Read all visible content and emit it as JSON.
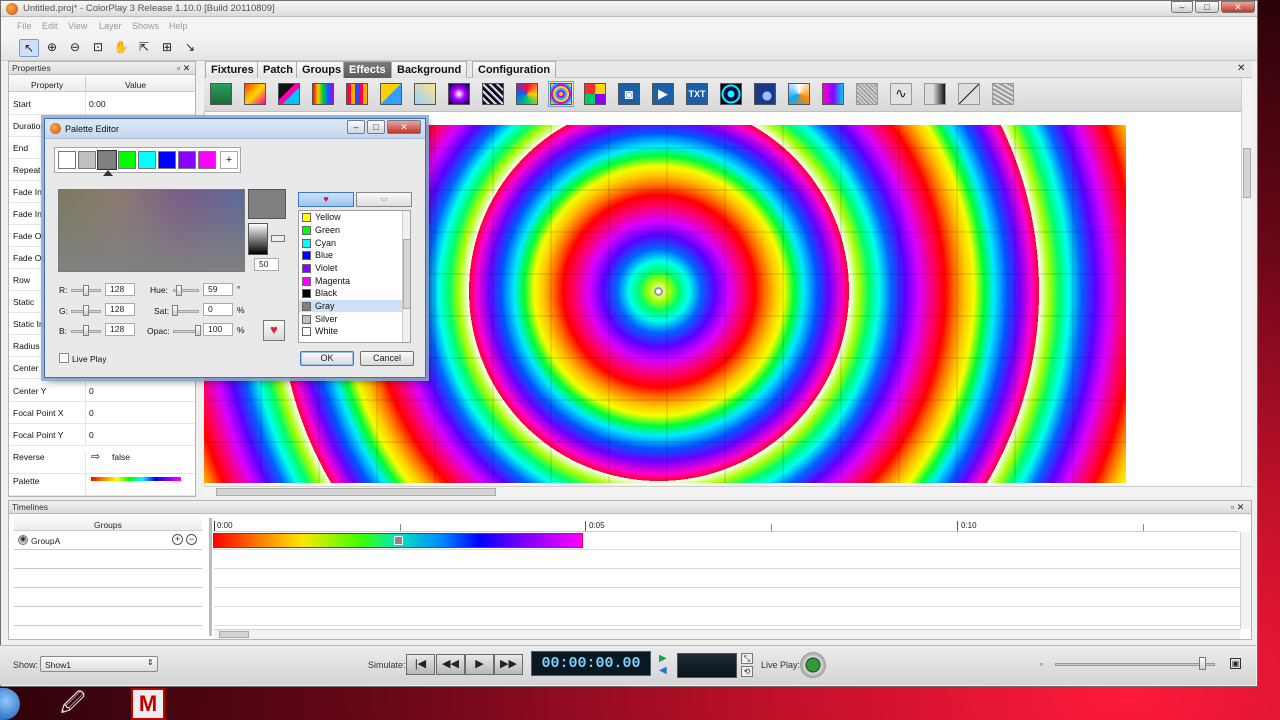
{
  "window": {
    "title": "Untitled.proj* - ColorPlay 3 Release 1.10.0 [Build 20110809]"
  },
  "menu": [
    "File",
    "Edit",
    "View",
    "Layer",
    "Shows",
    "Help"
  ],
  "properties": {
    "title": "Properties",
    "col_property": "Property",
    "col_value": "Value",
    "rows": [
      {
        "key": "Start",
        "value": "0:00"
      },
      {
        "key": "Duration",
        "value": ""
      },
      {
        "key": "End",
        "value": ""
      },
      {
        "key": "Repeat",
        "value": ""
      },
      {
        "key": "Fade In",
        "value": ""
      },
      {
        "key": "Fade In",
        "value": ""
      },
      {
        "key": "Fade Out",
        "value": ""
      },
      {
        "key": "Fade Out",
        "value": ""
      },
      {
        "key": "Row",
        "value": ""
      },
      {
        "key": "Static",
        "value": ""
      },
      {
        "key": "Static In",
        "value": ""
      },
      {
        "key": "Radius",
        "value": ""
      },
      {
        "key": "Center",
        "value": ""
      },
      {
        "key": "Center Y",
        "value": "0"
      },
      {
        "key": "Focal Point X",
        "value": "0"
      },
      {
        "key": "Focal Point Y",
        "value": "0"
      },
      {
        "key": "Reverse",
        "value": "false"
      },
      {
        "key": "Palette",
        "value": ""
      }
    ]
  },
  "tabs": [
    "Fixtures",
    "Patch",
    "Groups",
    "Effects",
    "Background",
    "Configuration"
  ],
  "effect_icons": [
    "solid-fx-icon",
    "gradient-fx-icon",
    "diagonal-fx-icon",
    "bars-fx-icon",
    "columns-fx-icon",
    "wipe-fx-icon",
    "tiles-fx-icon",
    "spotlight-fx-icon",
    "stripes-fx-icon",
    "swirl-fx-icon",
    "circles-fx-icon",
    "pinwheel-fx-icon",
    "camera-icon",
    "video-icon",
    "text-fx-icon",
    "lens-fx-icon",
    "orbit-fx-icon",
    "burst-fx-icon",
    "rainbow-fx-icon",
    "grid-fx-icon",
    "wave-fx-icon",
    "ramp-fx-icon",
    "slope-fx-icon",
    "noise-fx-icon"
  ],
  "effect_text_icon": "TXT",
  "palette_editor": {
    "title": "Palette Editor",
    "swatches": [
      "#ffffff",
      "#c0c0c0",
      "#808080",
      "#00ff00",
      "#00ffff",
      "#0000ff",
      "#8800ff",
      "#ff00ff"
    ],
    "add_label": "+",
    "value_box": "50",
    "r_label": "R:",
    "r_value": "128",
    "g_label": "G:",
    "g_value": "128",
    "b_label": "B:",
    "b_value": "128",
    "hue_label": "Hue:",
    "hue_value": "59",
    "hue_unit": "°",
    "sat_label": "Sat:",
    "sat_value": "0",
    "sat_unit": "%",
    "opac_label": "Opac:",
    "opac_value": "100",
    "opac_unit": "%",
    "colors": [
      {
        "name": "Yellow",
        "hex": "#ffff00"
      },
      {
        "name": "Green",
        "hex": "#00ff00"
      },
      {
        "name": "Cyan",
        "hex": "#00ffff"
      },
      {
        "name": "Blue",
        "hex": "#0000ff"
      },
      {
        "name": "Violet",
        "hex": "#8800ff"
      },
      {
        "name": "Magenta",
        "hex": "#ff00ff"
      },
      {
        "name": "Black",
        "hex": "#000000"
      },
      {
        "name": "Gray",
        "hex": "#808080"
      },
      {
        "name": "Silver",
        "hex": "#c0c0c0"
      },
      {
        "name": "White",
        "hex": "#ffffff"
      }
    ],
    "live_play_label": "Live Play",
    "ok_label": "OK",
    "cancel_label": "Cancel"
  },
  "timelines": {
    "title": "Timelines",
    "groups_header": "Groups",
    "group_name": "GroupA",
    "ticks": [
      "0:00",
      "0:05",
      "0:10"
    ]
  },
  "player": {
    "show_label": "Show:",
    "show_value": "Show1",
    "simulate_label": "Simulate:",
    "timecode": "00:00:00.00",
    "live_play_label": "Live Play:"
  },
  "colors": {
    "accent_tab": "#666666",
    "timecode_fg": "#7fd0ff",
    "clip_border": "#e0005a"
  }
}
